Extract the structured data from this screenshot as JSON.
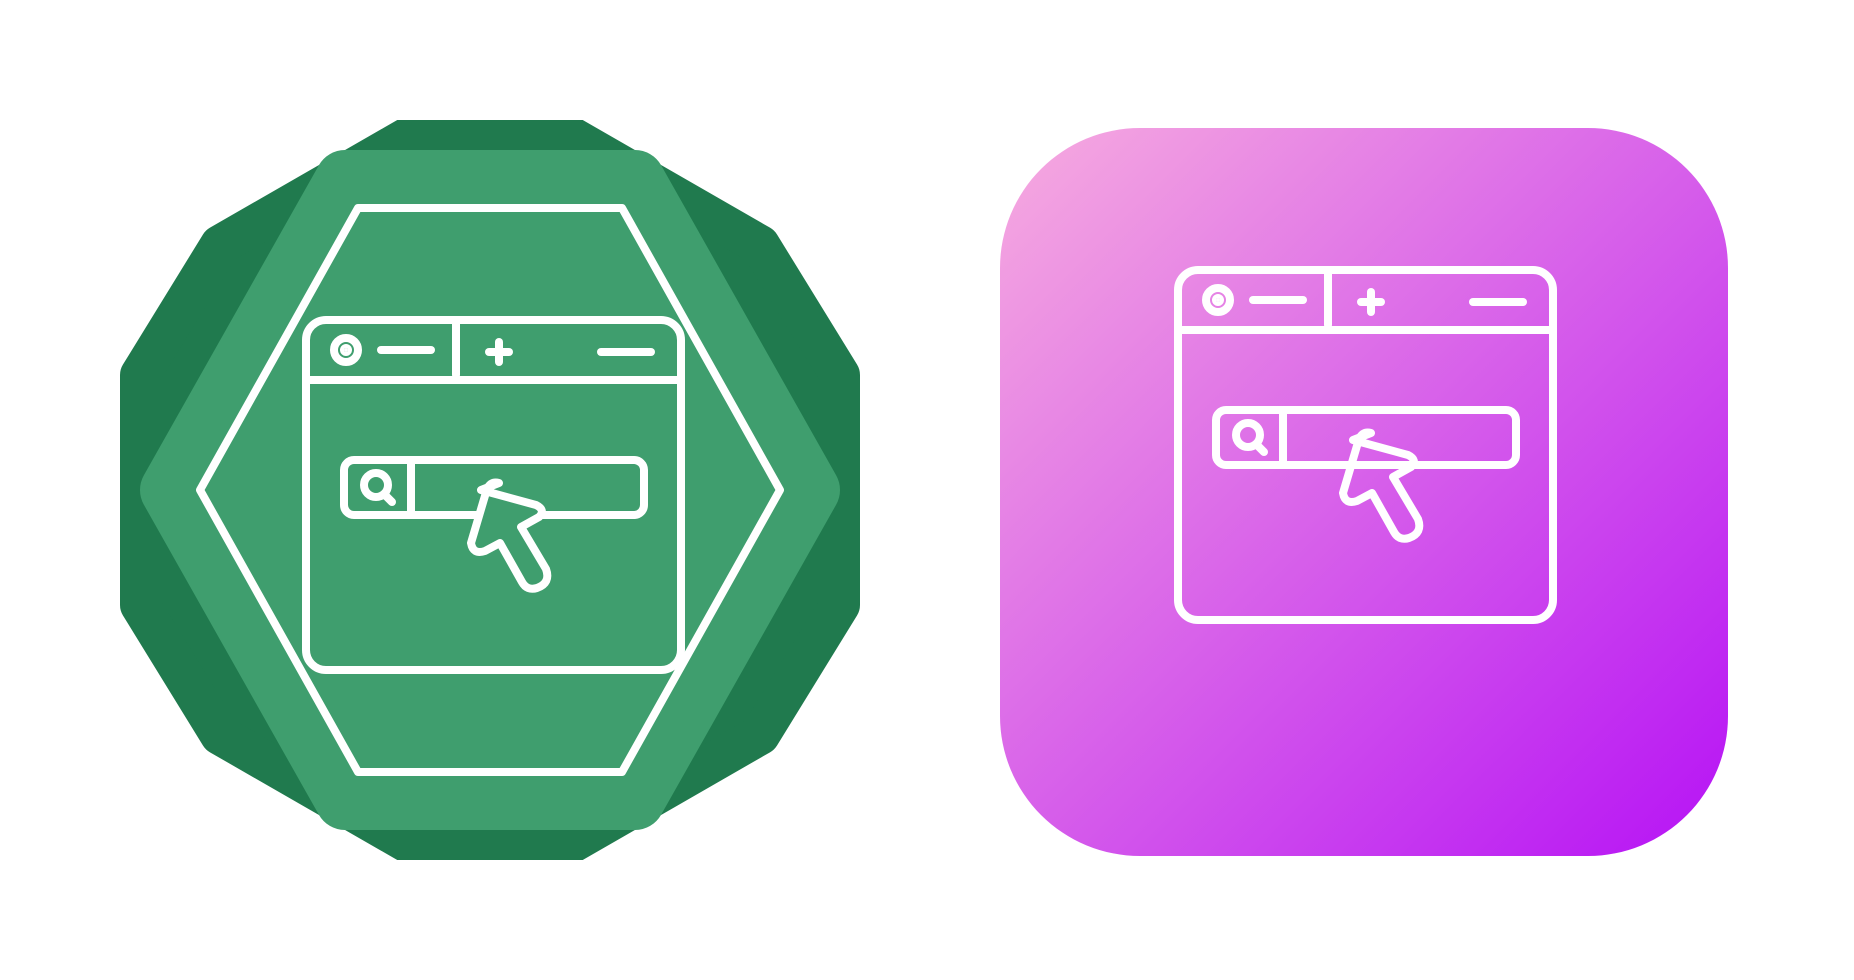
{
  "icons": [
    {
      "name": "browser-search-click-icon",
      "variant": "green-octagon-badge",
      "colors": {
        "outer": "#207a4e",
        "inner": "#3f9e6e",
        "stroke": "#ffffff"
      }
    },
    {
      "name": "browser-search-click-icon",
      "variant": "pink-purple-gradient-rounded-square",
      "colors": {
        "gradient_start": "#f7acdf",
        "gradient_end": "#b612f5",
        "stroke": "#ffffff"
      }
    }
  ]
}
